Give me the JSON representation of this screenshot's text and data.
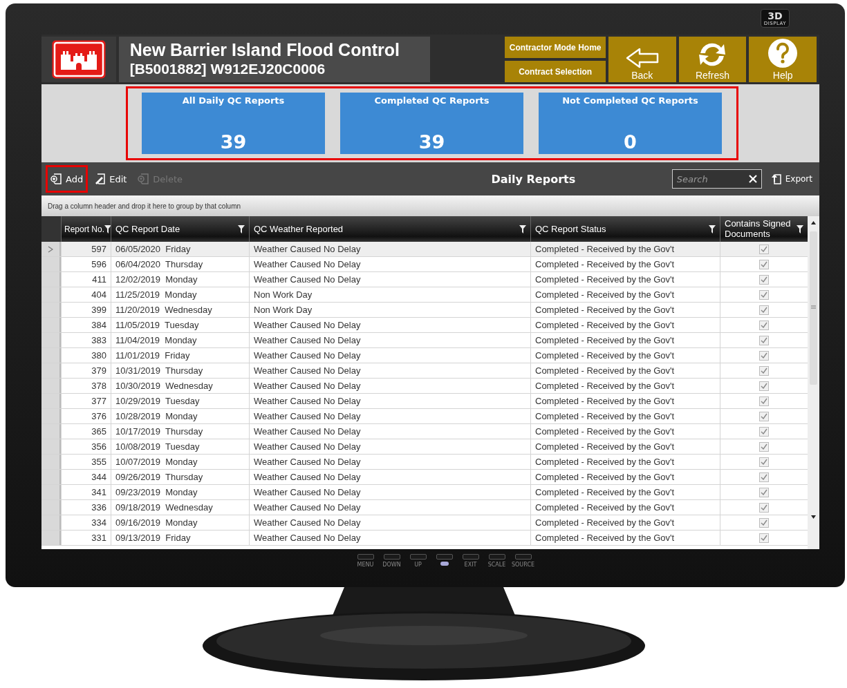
{
  "monitor": {
    "badge": "3D",
    "badge_sub": "DISPLAY",
    "controls": [
      {
        "kind": "button",
        "label": "MENU"
      },
      {
        "kind": "button",
        "label": "DOWN"
      },
      {
        "kind": "button",
        "label": "UP"
      },
      {
        "kind": "power"
      },
      {
        "kind": "button",
        "label": "EXIT"
      },
      {
        "kind": "button",
        "label": "SCALE"
      },
      {
        "kind": "button",
        "label": "SOURCE"
      }
    ]
  },
  "header": {
    "title": "New Barrier Island Flood Control",
    "subtitle": "[B5001882] W912EJ20C0006",
    "nav_buttons": [
      {
        "label": "Contractor Mode Home"
      },
      {
        "label": "Contract Selection"
      }
    ],
    "tiles": [
      {
        "kind": "back",
        "label": "Back"
      },
      {
        "kind": "refresh",
        "label": "Refresh"
      },
      {
        "kind": "help",
        "label": "Help"
      }
    ]
  },
  "summary": {
    "highlighted": true,
    "cards": [
      {
        "label": "All Daily QC Reports",
        "value": "39"
      },
      {
        "label": "Completed QC Reports",
        "value": "39"
      },
      {
        "label": "Not Completed QC Reports",
        "value": "0"
      }
    ]
  },
  "toolbar": {
    "title": "Daily Reports",
    "actions": [
      {
        "kind": "add",
        "label": "Add",
        "disabled": false,
        "highlighted": true
      },
      {
        "kind": "edit",
        "label": "Edit",
        "disabled": false,
        "highlighted": false
      },
      {
        "kind": "delete",
        "label": "Delete",
        "disabled": true,
        "highlighted": false
      }
    ],
    "search": {
      "placeholder": "Search"
    },
    "export": {
      "label": "Export"
    }
  },
  "group_hint": "Drag a column header and drop it here to group by that column",
  "table": {
    "columns": [
      {
        "label": "Report No."
      },
      {
        "label": "QC Report Date"
      },
      {
        "label": "QC Weather Reported"
      },
      {
        "label": "QC Report Status"
      },
      {
        "label": "Contains Signed Documents"
      }
    ],
    "rows": [
      {
        "selected": true,
        "report_no": "597",
        "date": "06/05/2020  Friday",
        "weather": "Weather Caused No Delay",
        "status": "Completed - Received by the Gov't",
        "signed": true
      },
      {
        "selected": false,
        "report_no": "596",
        "date": "06/04/2020  Thursday",
        "weather": "Weather Caused No Delay",
        "status": "Completed - Received by the Gov't",
        "signed": true
      },
      {
        "selected": false,
        "report_no": "411",
        "date": "12/02/2019  Monday",
        "weather": "Weather Caused No Delay",
        "status": "Completed - Received by the Gov't",
        "signed": true
      },
      {
        "selected": false,
        "report_no": "404",
        "date": "11/25/2019  Monday",
        "weather": "Non Work Day",
        "status": "Completed - Received by the Gov't",
        "signed": true
      },
      {
        "selected": false,
        "report_no": "399",
        "date": "11/20/2019  Wednesday",
        "weather": "Non Work Day",
        "status": "Completed - Received by the Gov't",
        "signed": true
      },
      {
        "selected": false,
        "report_no": "384",
        "date": "11/05/2019  Tuesday",
        "weather": "Weather Caused No Delay",
        "status": "Completed - Received by the Gov't",
        "signed": true
      },
      {
        "selected": false,
        "report_no": "383",
        "date": "11/04/2019  Monday",
        "weather": "Weather Caused No Delay",
        "status": "Completed - Received by the Gov't",
        "signed": true
      },
      {
        "selected": false,
        "report_no": "380",
        "date": "11/01/2019  Friday",
        "weather": "Weather Caused No Delay",
        "status": "Completed - Received by the Gov't",
        "signed": true
      },
      {
        "selected": false,
        "report_no": "379",
        "date": "10/31/2019  Thursday",
        "weather": "Weather Caused No Delay",
        "status": "Completed - Received by the Gov't",
        "signed": true
      },
      {
        "selected": false,
        "report_no": "378",
        "date": "10/30/2019  Wednesday",
        "weather": "Weather Caused No Delay",
        "status": "Completed - Received by the Gov't",
        "signed": true
      },
      {
        "selected": false,
        "report_no": "377",
        "date": "10/29/2019  Tuesday",
        "weather": "Weather Caused No Delay",
        "status": "Completed - Received by the Gov't",
        "signed": true
      },
      {
        "selected": false,
        "report_no": "376",
        "date": "10/28/2019  Monday",
        "weather": "Weather Caused No Delay",
        "status": "Completed - Received by the Gov't",
        "signed": true
      },
      {
        "selected": false,
        "report_no": "365",
        "date": "10/17/2019  Thursday",
        "weather": "Weather Caused No Delay",
        "status": "Completed - Received by the Gov't",
        "signed": true
      },
      {
        "selected": false,
        "report_no": "356",
        "date": "10/08/2019  Tuesday",
        "weather": "Weather Caused No Delay",
        "status": "Completed - Received by the Gov't",
        "signed": true
      },
      {
        "selected": false,
        "report_no": "355",
        "date": "10/07/2019  Monday",
        "weather": "Weather Caused No Delay",
        "status": "Completed - Received by the Gov't",
        "signed": true
      },
      {
        "selected": false,
        "report_no": "344",
        "date": "09/26/2019  Thursday",
        "weather": "Weather Caused No Delay",
        "status": "Completed - Received by the Gov't",
        "signed": true
      },
      {
        "selected": false,
        "report_no": "341",
        "date": "09/23/2019  Monday",
        "weather": "Weather Caused No Delay",
        "status": "Completed - Received by the Gov't",
        "signed": true
      },
      {
        "selected": false,
        "report_no": "336",
        "date": "09/18/2019  Wednesday",
        "weather": "Weather Caused No Delay",
        "status": "Completed - Received by the Gov't",
        "signed": true
      },
      {
        "selected": false,
        "report_no": "334",
        "date": "09/16/2019  Monday",
        "weather": "Weather Caused No Delay",
        "status": "Completed - Received by the Gov't",
        "signed": true
      },
      {
        "selected": false,
        "report_no": "331",
        "date": "09/13/2019  Friday",
        "weather": "Weather Caused No Delay",
        "status": "Completed - Received by the Gov't",
        "signed": true
      }
    ]
  }
}
